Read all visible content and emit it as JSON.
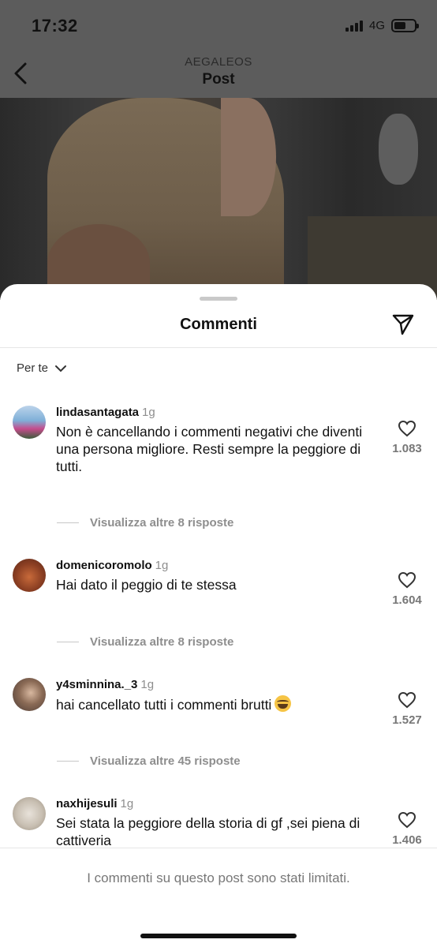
{
  "status_bar": {
    "time": "17:32",
    "network": "4G",
    "battery_level": 0.6
  },
  "header": {
    "account": "AEGALEOS",
    "title": "Post"
  },
  "sheet": {
    "title": "Commenti",
    "sort_label": "Per te"
  },
  "comments": [
    {
      "username": "lindasantagata",
      "time": "1g",
      "text": "Non è cancellando i commenti negativi che diventi una persona migliore. Resti sempre la peggiore di tutti.",
      "likes": "1.083",
      "replies": "Visualizza altre 8 risposte"
    },
    {
      "username": "domenicoromolo",
      "time": "1g",
      "text": "Hai dato il peggio di te stessa",
      "likes": "1.604",
      "replies": "Visualizza altre 8 risposte"
    },
    {
      "username": "y4sminnina._3",
      "time": "1g",
      "text": "hai cancellato tutti i commenti brutti",
      "likes": "1.527",
      "replies": "Visualizza altre 45 risposte"
    },
    {
      "username": "naxhijesuli",
      "time": "1g",
      "text": "Sei stata la peggiore  della storia di gf ,sei piena di cattiveria",
      "likes": "1.406"
    }
  ],
  "footer": {
    "notice": "I commenti su questo post sono stati limitati."
  },
  "colors": {
    "dim_overlay": "#5c5c5c",
    "secondary_text": "#8e8e8e",
    "sheet_bg": "#ffffff"
  }
}
